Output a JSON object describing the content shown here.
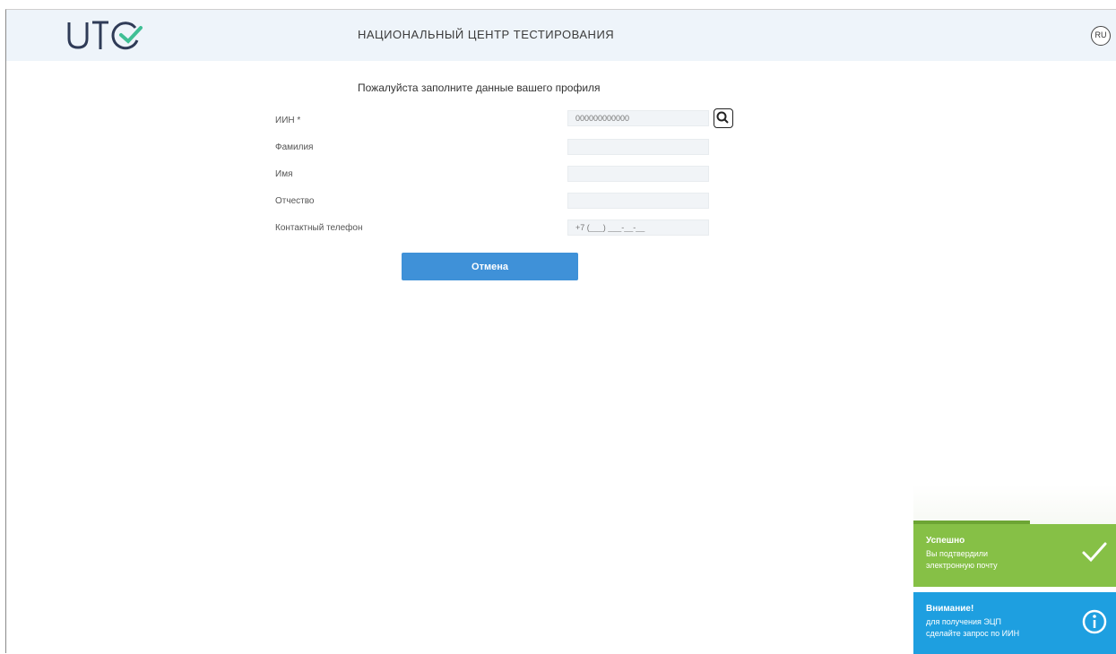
{
  "header": {
    "title": "НАЦИОНАЛЬНЫЙ ЦЕНТР ТЕСТИРОВАНИЯ",
    "lang": "RU",
    "logo_text": "UTC",
    "colors": {
      "bg": "#eef4fa",
      "logo_dark": "#2f3b57",
      "logo_accent": "#3fbf95"
    }
  },
  "form": {
    "title": "Пожалуйста заполните данные вашего профиля",
    "fields": [
      {
        "label": "ИИН *",
        "value": "",
        "placeholder": "000000000000"
      },
      {
        "label": "Фамилия",
        "value": "",
        "placeholder": ""
      },
      {
        "label": "Имя",
        "value": "",
        "placeholder": ""
      },
      {
        "label": "Отчество",
        "value": "",
        "placeholder": ""
      },
      {
        "label": "Контактный телефон",
        "value": "",
        "placeholder": "+7 (___) ___-__-__"
      }
    ],
    "search_icon": "search-icon",
    "save_label": "Отмена"
  },
  "toasts": {
    "success": {
      "title": "Успешно",
      "line1": "Вы подтвердили",
      "line2": "электронную почту",
      "icon": "checkmark-icon",
      "color": "#86c046"
    },
    "info": {
      "title": "Внимание!",
      "line1": "для получения ЭЦП",
      "line2": "сделайте запрос по ИИН",
      "icon": "info-icon",
      "color": "#1e9fe0"
    }
  }
}
